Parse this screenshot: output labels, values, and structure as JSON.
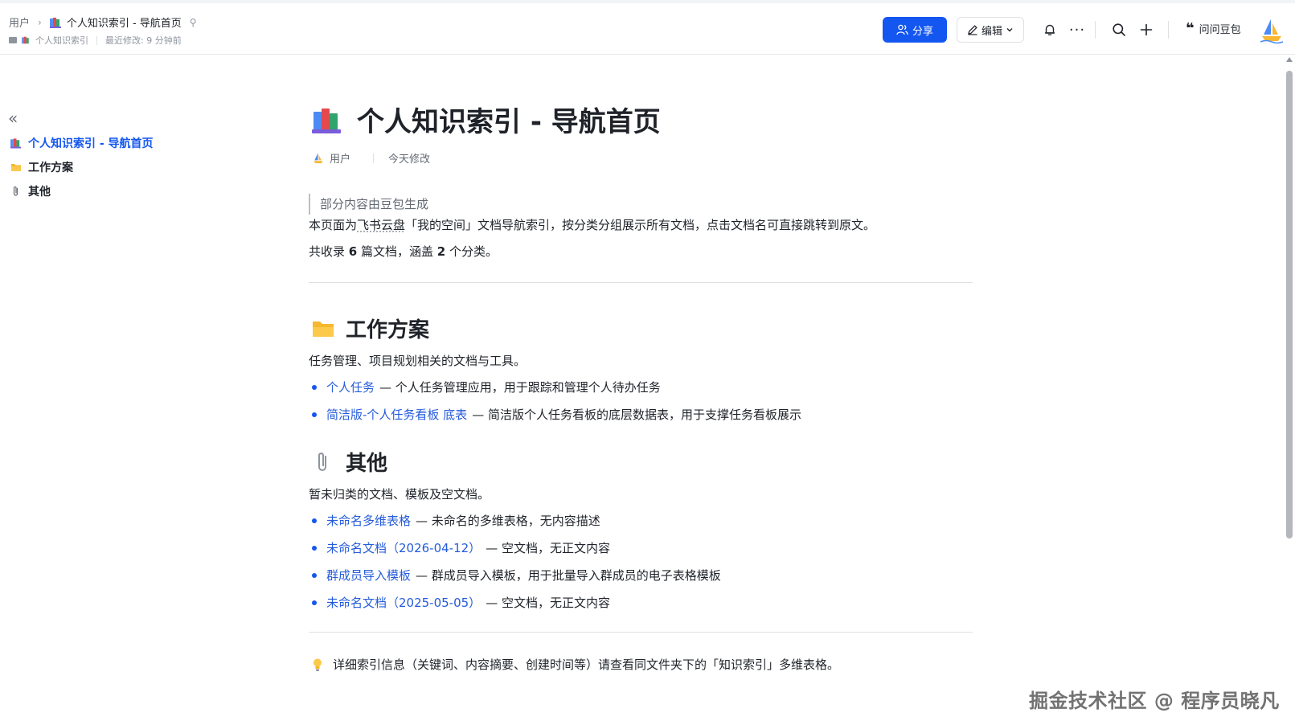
{
  "header": {
    "breadcrumb_root": "用户",
    "breadcrumb_current": "个人知识索引 - 导航首页",
    "sub_doc_name": "个人知识索引",
    "last_modified": "最近修改: 9 分钟前",
    "share_label": "分享",
    "edit_label": "编辑",
    "ask_label": "问问豆包"
  },
  "sidebar": {
    "items": [
      {
        "label": "个人知识索引 - 导航首页",
        "icon": "books-icon"
      },
      {
        "label": "工作方案",
        "icon": "folder-icon"
      },
      {
        "label": "其他",
        "icon": "paperclip-icon"
      }
    ]
  },
  "doc": {
    "title": "个人知识索引 - 导航首页",
    "author": "用户",
    "modified": "今天修改",
    "callout": "部分内容由豆包生成",
    "intro_before": "本页面为",
    "intro_link": "飞书云盘",
    "intro_after": "「我的空间」文档导航索引，按分类分组展示所有文档，点击文档名可直接跳转到原文。",
    "count_prefix": "共收录 ",
    "count_docs": "6",
    "count_mid": " 篇文档，涵盖 ",
    "count_cats": "2",
    "count_suffix": " 个分类。",
    "sections": [
      {
        "heading": "工作方案",
        "desc": "任务管理、项目规划相关的文档与工具。",
        "items": [
          {
            "link": "个人任务",
            "desc": "— 个人任务管理应用，用于跟踪和管理个人待办任务"
          },
          {
            "link": "简洁版-个人任务看板 底表",
            "desc": "— 简洁版个人任务看板的底层数据表，用于支撑任务看板展示"
          }
        ]
      },
      {
        "heading": "其他",
        "desc": "暂未归类的文档、模板及空文档。",
        "items": [
          {
            "link": "未命名多维表格",
            "desc": "— 未命名的多维表格，无内容描述"
          },
          {
            "link": "未命名文档（2026-04-12）",
            "desc": "— 空文档，无正文内容"
          },
          {
            "link": "群成员导入模板",
            "desc": "— 群成员导入模板，用于批量导入群成员的电子表格模板"
          },
          {
            "link": "未命名文档（2025-05-05）",
            "desc": "— 空文档，无正文内容"
          }
        ]
      }
    ],
    "tip": "详细索引信息（关键词、内容摘要、创建时间等）请查看同文件夹下的「知识索引」多维表格。"
  },
  "watermark": "掘金技术社区 @ 程序员晓凡",
  "colors": {
    "accent": "#1456f0",
    "link": "#245bdb",
    "text": "#1f2329",
    "muted": "#646a73"
  }
}
